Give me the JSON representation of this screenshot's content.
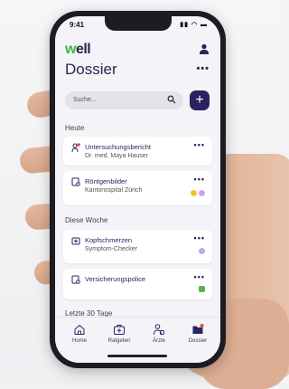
{
  "status_bar": {
    "time": "9:41",
    "icons": "▮▮ ◠ ▬"
  },
  "app": {
    "logo_part1": "w",
    "logo_part2": "ell",
    "title": "Dossier",
    "more_label": "•••"
  },
  "search": {
    "placeholder": "Suche...",
    "add_label": "+"
  },
  "sections": {
    "today": "Heute",
    "week": "Diese Woche",
    "last30": "Letzte 30 Tage"
  },
  "cards": [
    {
      "title": "Untersuchungsbericht",
      "subtitle": "Dr. med. Maya Hauser",
      "icon": "doctor-report-icon",
      "more": "•••",
      "tags": []
    },
    {
      "title": "Röntgenbilder",
      "subtitle": "Kantonsspital Zürich",
      "icon": "xray-icon",
      "more": "•••",
      "tags": [
        "#f2c230",
        "#c7a6f0"
      ]
    },
    {
      "title": "Kopfschmerzen",
      "subtitle": "Symptom-Checker",
      "icon": "symptom-icon",
      "more": "•••",
      "tags": [
        "#c7a6f0"
      ]
    },
    {
      "title": "Versicherungspolice",
      "subtitle": "",
      "icon": "document-icon",
      "more": "•••",
      "tags": [
        "#5fb04a"
      ]
    }
  ],
  "tabs": [
    {
      "label": "Home",
      "icon": "home-icon",
      "active": false
    },
    {
      "label": "Ratgeber",
      "icon": "medkit-icon",
      "active": false
    },
    {
      "label": "Ärzte",
      "icon": "doctor-icon",
      "active": false
    },
    {
      "label": "Dossier",
      "icon": "folder-icon",
      "active": true
    }
  ],
  "colors": {
    "brand": "#2a2260",
    "accent_green": "#3bb54a",
    "notification": "#e04848"
  }
}
